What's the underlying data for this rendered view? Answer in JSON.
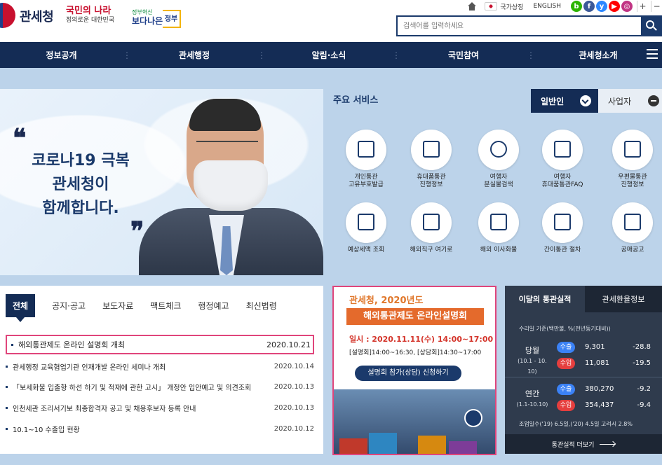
{
  "header": {
    "logo_text": "관세청",
    "slogan_main_1": "국민의 나라",
    "slogan_main_2": "정의로운 대한민국",
    "slogan_gov_top": "정부혁신",
    "slogan_gov_main": "보다나은",
    "slogan_gov_end": "정부",
    "util": {
      "national_symbol": "국가상징",
      "english": "ENGLISH",
      "sns": [
        "b",
        "f",
        "y",
        "▶",
        "◎"
      ],
      "sns_colors": [
        "#2db400",
        "#3b5998",
        "#2d88ff",
        "#ff0000",
        "#c13584"
      ],
      "zoom_in": "+",
      "zoom_out": "−"
    },
    "search": {
      "placeholder": "검색어를 입력하세요"
    }
  },
  "gnb": [
    "정보공개",
    "관세행정",
    "알림·소식",
    "국민참여",
    "관세청소개"
  ],
  "hero": {
    "lines": [
      "코로나19 극복",
      "관세청이",
      "함께합니다."
    ],
    "quote_open": "❝",
    "quote_close": "❞"
  },
  "services": {
    "title": "주요 서비스",
    "tab_general": "일반인",
    "tab_business": "사업자",
    "items": [
      {
        "label1": "개인통관",
        "label2": "고유부호발급",
        "icon": "laptop-icon"
      },
      {
        "label1": "휴대품통관",
        "label2": "진행정보",
        "icon": "screen-icon"
      },
      {
        "label1": "여행자",
        "label2": "분실물검색",
        "icon": "magnifier-icon"
      },
      {
        "label1": "여행자",
        "label2": "휴대품통관FAQ",
        "icon": "briefcase-icon"
      },
      {
        "label1": "우편물통관",
        "label2": "진행정보",
        "icon": "mail-icon"
      },
      {
        "label1": "예상세액 조회",
        "label2": "",
        "icon": "calculator-icon"
      },
      {
        "label1": "해외직구 여기로",
        "label2": "",
        "icon": "cart-icon"
      },
      {
        "label1": "해외 이사화물",
        "label2": "",
        "icon": "box-icon"
      },
      {
        "label1": "간이통관 절차",
        "label2": "",
        "icon": "clipboard-icon"
      },
      {
        "label1": "공매공고",
        "label2": "",
        "icon": "megaphone-icon"
      }
    ]
  },
  "news": {
    "tabs": [
      "전체",
      "공지·공고",
      "보도자료",
      "팩트체크",
      "행정예고",
      "최신법령"
    ],
    "rows": [
      {
        "title": "해외통관제도 온라인 설명회 개최",
        "date": "2020.10.21"
      },
      {
        "title": "관세행정 교육협업기관 인재개발 온라인 세미나 개최",
        "date": "2020.10.14"
      },
      {
        "title": "「보세화물 입출항 하선 하기 및 적재에 관한 고시」 개정안 입안예고 및 의견조회",
        "date": "2020.10.13"
      },
      {
        "title": "인천세관 조리서기보 최종합격자 공고 및 채용후보자 등록 안내",
        "date": "2020.10.13"
      },
      {
        "title": "10.1~10 수출입 현황",
        "date": "2020.10.12"
      }
    ]
  },
  "promo": {
    "line1": "관세청, 2020년도",
    "line2": "해외통관제도 온라인설명회",
    "date": "일시 : 2020.11.11(수) 14:00~17:00",
    "sessions": "[설명회]14:00~16:30, [상담회]14:30~17:00",
    "cta": "설명회 참가(상담) 신청하기"
  },
  "stats": {
    "tab_active": "이달의 통관실적",
    "tab_other": "관세환율정보",
    "basis": "수리일 기준(백만불, %(전년동기대비))",
    "periods": [
      {
        "label": "당월",
        "range": "(10.1 - 10. 10)",
        "export_label": "수출",
        "export_value": "9,301",
        "export_pct": "-28.8",
        "import_label": "수입",
        "import_value": "11,081",
        "import_pct": "-19.5"
      },
      {
        "label": "연간",
        "range": "(1.1-10.10)",
        "export_label": "수출",
        "export_value": "380,270",
        "export_pct": "-9.2",
        "import_label": "수입",
        "import_value": "354,437",
        "import_pct": "-9.4"
      }
    ],
    "note": "조업일수('19) 6.5일,('20) 4.5일 고려시 2.8%",
    "more": "통관실적 더보기"
  }
}
